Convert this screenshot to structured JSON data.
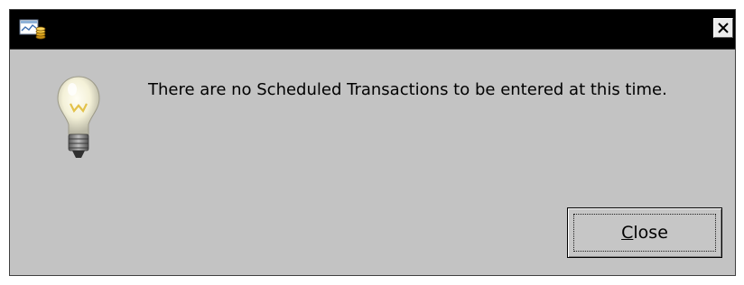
{
  "window": {
    "title": "",
    "message": "There are no Scheduled Transactions to be entered at this time."
  },
  "buttons": {
    "close_label_mnemonic": "C",
    "close_label_rest": "lose"
  },
  "icons": {
    "app": "app-chart-coins-icon",
    "titlebar_close": "close-icon",
    "info": "lightbulb-icon"
  },
  "colors": {
    "dialog_background": "#c3c3c3",
    "titlebar": "#000000"
  }
}
